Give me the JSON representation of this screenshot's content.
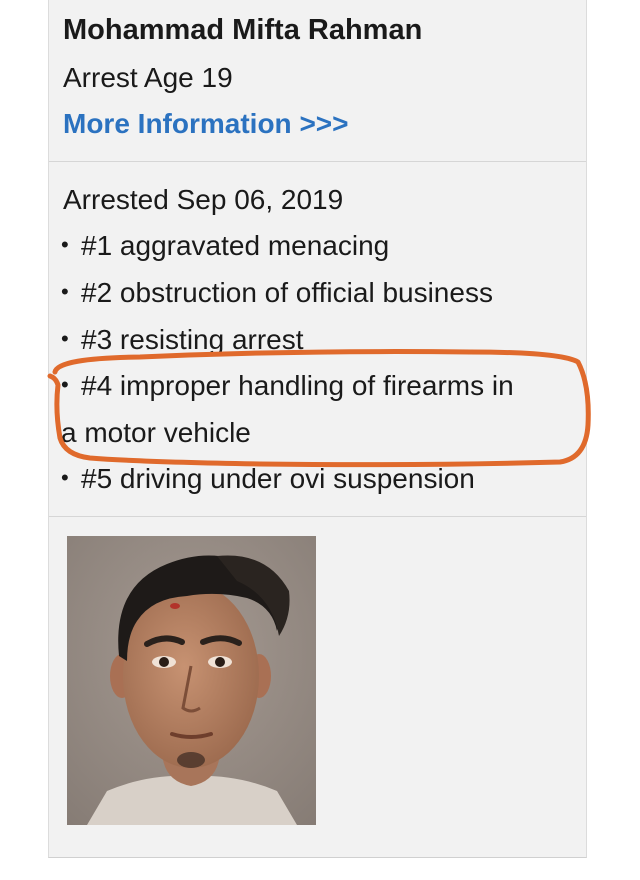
{
  "profile": {
    "name": "Mohammad Mifta Rahman",
    "arrest_age": "Arrest Age 19",
    "more_info_link": "More Information >>>"
  },
  "arrest": {
    "date": "Arrested Sep 06, 2019",
    "charges": [
      "#1 aggravated menacing",
      "#2 obstruction of official business",
      "#3 resisting arrest",
      "#4 improper handling of firearms in",
      "#5 driving under ovi suspension"
    ],
    "charge_4_continuation": "a motor vehicle"
  },
  "mugshot": {
    "icon": "mugshot-photo"
  },
  "colors": {
    "link": "#2b72c0",
    "annotation": "#e06a2c",
    "card_bg": "#f2f2f2"
  }
}
